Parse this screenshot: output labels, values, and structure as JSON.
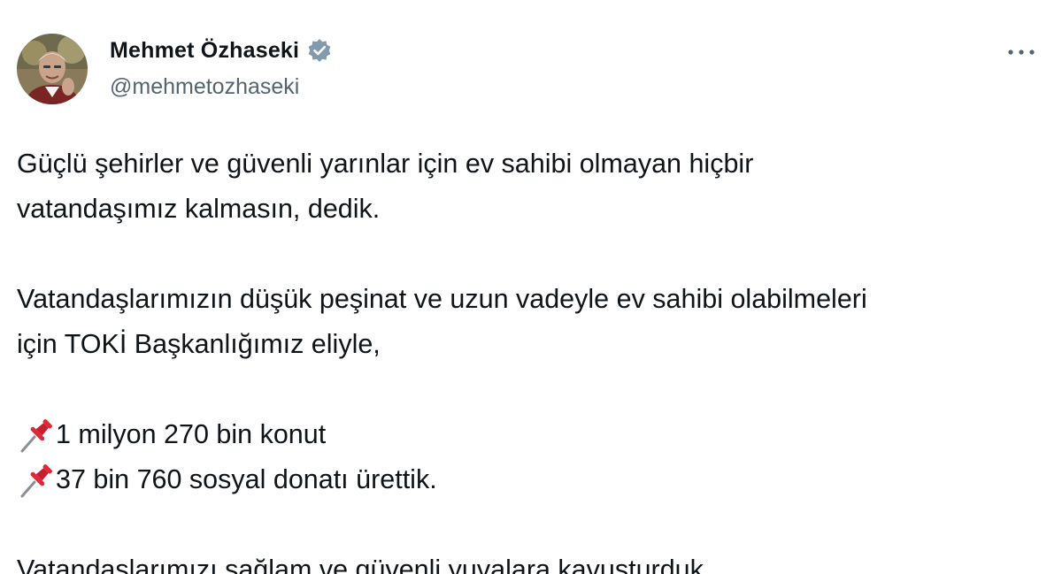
{
  "author": {
    "display_name": "Mehmet Özhaseki",
    "handle": "@mehmetozhaseki",
    "verified": true,
    "verified_icon": "verified-badge-icon",
    "avatar_icon": "profile-photo"
  },
  "menu": {
    "icon": "more-options-icon",
    "glyph": "···"
  },
  "tweet": {
    "paragraph_1_line_1": "Güçlü şehirler ve güvenli yarınlar için ev sahibi olmayan hiçbir",
    "paragraph_1_line_2": "vatandaşımız kalmasın, dedik.",
    "paragraph_2_line_1": "Vatandaşlarımızın düşük peşinat ve uzun vadeyle ev sahibi olabilmeleri",
    "paragraph_2_line_2": "için TOKİ Başkanlığımız eliyle,",
    "list": [
      {
        "icon": "pushpin-icon",
        "text": "1 milyon 270 bin konut"
      },
      {
        "icon": "pushpin-icon",
        "text": "37 bin 760 sosyal donatı ürettik."
      }
    ],
    "paragraph_3": "Vatandaşlarımızı sağlam ve güvenli yuvalara kavuşturduk."
  },
  "colors": {
    "text_primary": "#0f1419",
    "text_secondary": "#536471",
    "verified_badge": "#829aab",
    "pushpin_red": "#e0283a"
  }
}
